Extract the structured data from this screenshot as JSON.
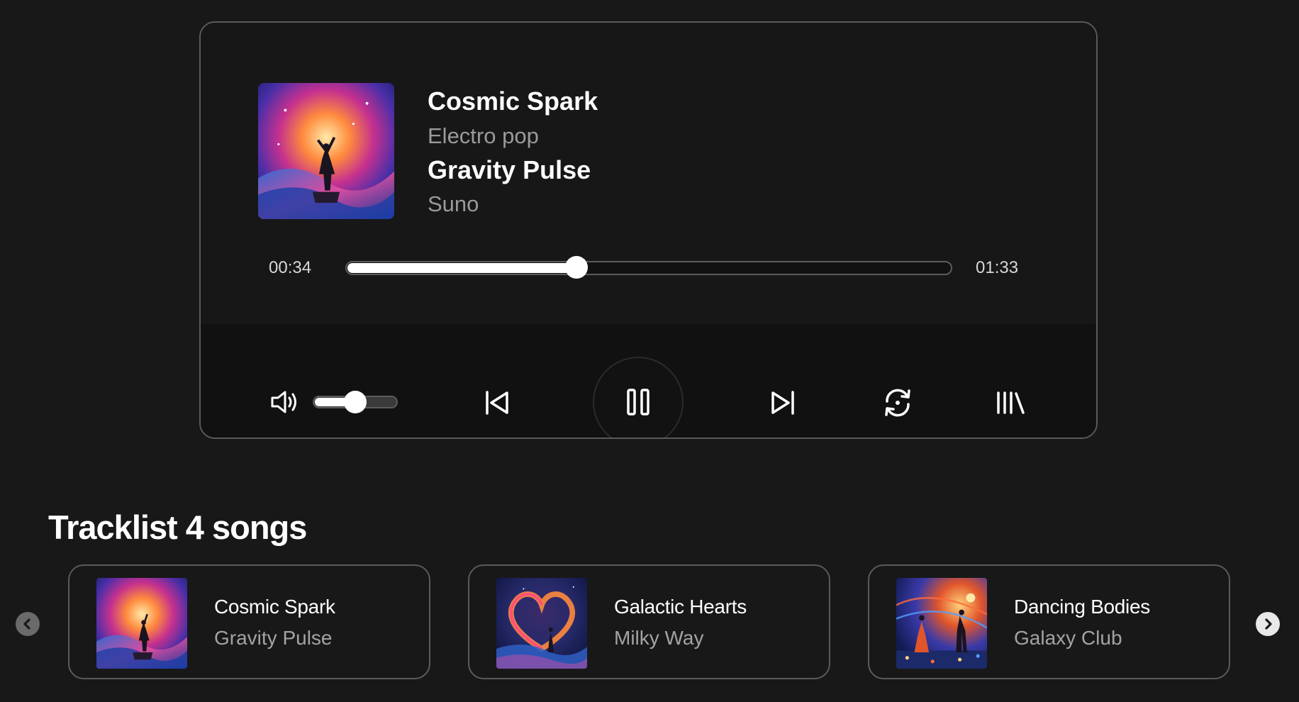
{
  "now_playing": {
    "title": "Cosmic Spark",
    "genre": "Electro pop",
    "album": "Gravity Pulse",
    "artist": "Suno",
    "cover_icon": "cosmic-spark-cover-art",
    "current_time": "00:34",
    "total_time": "01:33",
    "progress_fraction": 0.38
  },
  "controls": {
    "volume_icon": "volume-high-icon",
    "volume_fraction": 0.5,
    "prev_icon": "skip-previous-icon",
    "play_icon": "pause-icon",
    "next_icon": "skip-next-icon",
    "repeat_icon": "repeat-icon",
    "library_icon": "library-icon"
  },
  "tracklist": {
    "heading": "Tracklist 4 songs",
    "prev_arrow_icon": "chevron-left-icon",
    "next_arrow_icon": "chevron-right-icon",
    "items": [
      {
        "title": "Cosmic Spark",
        "album": "Gravity Pulse",
        "art": "cosmic-spark-art"
      },
      {
        "title": "Galactic Hearts",
        "album": "Milky Way",
        "art": "galactic-hearts-art"
      },
      {
        "title": "Dancing Bodies",
        "album": "Galaxy Club",
        "art": "dancing-bodies-art"
      }
    ]
  },
  "colors": {
    "background": "#181818",
    "card_border": "#5a5a5a",
    "accent": "#ffffff",
    "muted_text": "#9a9a9a"
  }
}
